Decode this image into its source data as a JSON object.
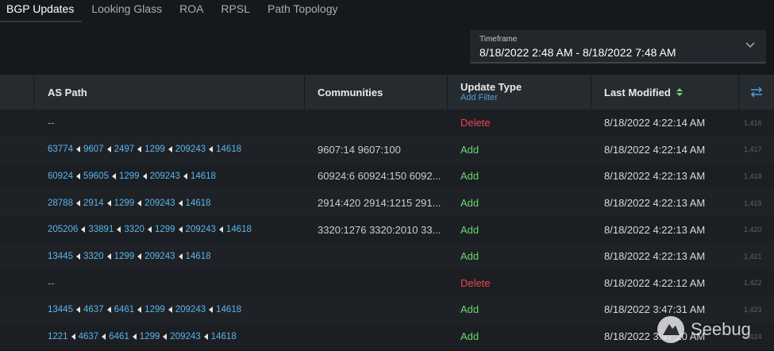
{
  "tabs": [
    {
      "label": "BGP Updates",
      "active": true
    },
    {
      "label": "Looking Glass",
      "active": false
    },
    {
      "label": "ROA",
      "active": false
    },
    {
      "label": "RPSL",
      "active": false
    },
    {
      "label": "Path Topology",
      "active": false
    }
  ],
  "timeframe": {
    "label": "Timeframe",
    "value": "8/18/2022 2:48 AM - 8/18/2022 7:48 AM",
    "icon": "chevron-down-icon"
  },
  "table": {
    "columns": {
      "as_path": "AS Path",
      "communities": "Communities",
      "update_type": "Update Type",
      "update_type_sub": "Add Filter",
      "last_modified": "Last Modified"
    },
    "rows": [
      {
        "path": [],
        "path_text": "--",
        "communities": "",
        "type": "Delete",
        "modified": "8/18/2022 4:22:14 AM",
        "id": "1,416"
      },
      {
        "path": [
          "63774",
          "9607",
          "2497",
          "1299",
          "209243",
          "14618"
        ],
        "communities": "9607:14 9607:100",
        "type": "Add",
        "modified": "8/18/2022 4:22:14 AM",
        "id": "1,417"
      },
      {
        "path": [
          "60924",
          "59605",
          "1299",
          "209243",
          "14618"
        ],
        "communities": "60924:6 60924:150 6092...",
        "type": "Add",
        "modified": "8/18/2022 4:22:13 AM",
        "id": "1,418"
      },
      {
        "path": [
          "28788",
          "2914",
          "1299",
          "209243",
          "14618"
        ],
        "communities": "2914:420 2914:1215 291...",
        "type": "Add",
        "modified": "8/18/2022 4:22:13 AM",
        "id": "1,419"
      },
      {
        "path": [
          "205206",
          "33891",
          "3320",
          "1299",
          "209243",
          "14618"
        ],
        "communities": "3320:1276 3320:2010 33...",
        "type": "Add",
        "modified": "8/18/2022 4:22:13 AM",
        "id": "1,420"
      },
      {
        "path": [
          "13445",
          "3320",
          "1299",
          "209243",
          "14618"
        ],
        "communities": "",
        "type": "Add",
        "modified": "8/18/2022 4:22:13 AM",
        "id": "1,421"
      },
      {
        "path": [],
        "path_text": "--",
        "communities": "",
        "type": "Delete",
        "modified": "8/18/2022 4:22:12 AM",
        "id": "1,422"
      },
      {
        "path": [
          "13445",
          "4637",
          "6461",
          "1299",
          "209243",
          "14618"
        ],
        "communities": "",
        "type": "Add",
        "modified": "8/18/2022 3:47:31 AM",
        "id": "1,423"
      },
      {
        "path": [
          "1221",
          "4637",
          "6461",
          "1299",
          "209243",
          "14618"
        ],
        "communities": "",
        "type": "Add",
        "modified": "8/18/2022 3:47:20 AM",
        "id": "1,424"
      }
    ]
  },
  "watermark": {
    "text": "Seebug"
  },
  "colors": {
    "add": "#6bd86b",
    "delete": "#e8474e",
    "asn_link": "#5db4ea",
    "accent_sort": "#6bd86b"
  }
}
